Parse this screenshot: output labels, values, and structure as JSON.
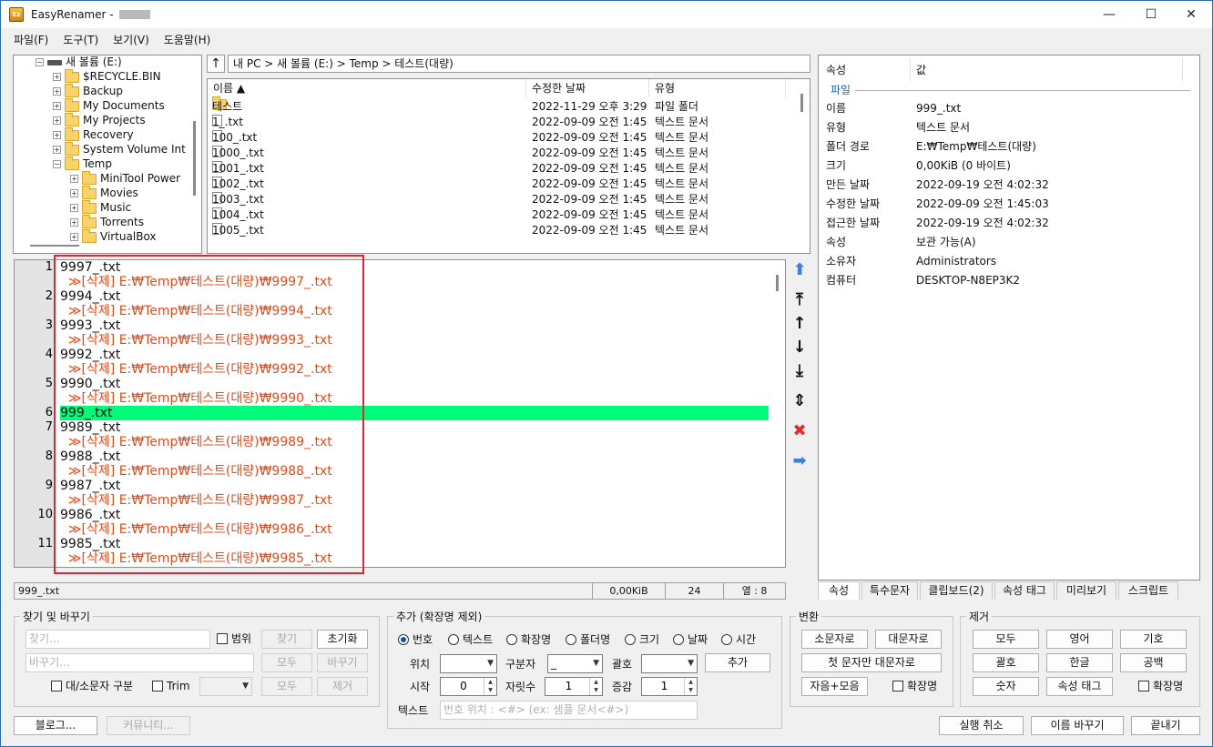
{
  "window": {
    "title": "EasyRenamer -",
    "min": "—",
    "max": "☐",
    "close": "✕"
  },
  "menu": [
    "파일(F)",
    "도구(T)",
    "보기(V)",
    "도움말(H)"
  ],
  "tree": [
    {
      "label": "새 볼륨 (E:)",
      "indent": 0,
      "icon": "drive",
      "exp": "−"
    },
    {
      "label": "$RECYCLE.BIN",
      "indent": 1,
      "icon": "folder",
      "exp": "+"
    },
    {
      "label": "Backup",
      "indent": 1,
      "icon": "folder",
      "exp": "+"
    },
    {
      "label": "My Documents",
      "indent": 1,
      "icon": "folder",
      "exp": "+"
    },
    {
      "label": "My Projects",
      "indent": 1,
      "icon": "folder",
      "exp": "+"
    },
    {
      "label": "Recovery",
      "indent": 1,
      "icon": "folder",
      "exp": "+"
    },
    {
      "label": "System Volume Int",
      "indent": 1,
      "icon": "folder",
      "exp": "+"
    },
    {
      "label": "Temp",
      "indent": 1,
      "icon": "folder",
      "exp": "−"
    },
    {
      "label": "MiniTool Power",
      "indent": 2,
      "icon": "folder",
      "exp": "+"
    },
    {
      "label": "Movies",
      "indent": 2,
      "icon": "folder",
      "exp": "+"
    },
    {
      "label": "Music",
      "indent": 2,
      "icon": "folder",
      "exp": "+"
    },
    {
      "label": "Torrents",
      "indent": 2,
      "icon": "folder",
      "exp": "+"
    },
    {
      "label": "VirtualBox",
      "indent": 2,
      "icon": "folder",
      "exp": "+"
    }
  ],
  "address": {
    "up": "↑",
    "path": "내 PC > 새 볼륨 (E:) > Temp > 테스트(대량)"
  },
  "filelist": {
    "columns": [
      "이름 ▲",
      "수정한 날짜",
      "유형"
    ],
    "rows": [
      {
        "name": "테스트",
        "date": "2022-11-29 오후 3:29",
        "type": "파일 폴더",
        "folder": true
      },
      {
        "name": "1_.txt",
        "date": "2022-09-09 오전 1:45",
        "type": "텍스트 문서"
      },
      {
        "name": "100_.txt",
        "date": "2022-09-09 오전 1:45",
        "type": "텍스트 문서"
      },
      {
        "name": "1000_.txt",
        "date": "2022-09-09 오전 1:45",
        "type": "텍스트 문서"
      },
      {
        "name": "1001_.txt",
        "date": "2022-09-09 오전 1:45",
        "type": "텍스트 문서"
      },
      {
        "name": "1002_.txt",
        "date": "2022-09-09 오전 1:45",
        "type": "텍스트 문서"
      },
      {
        "name": "1003_.txt",
        "date": "2022-09-09 오전 1:45",
        "type": "텍스트 문서"
      },
      {
        "name": "1004_.txt",
        "date": "2022-09-09 오전 1:45",
        "type": "텍스트 문서"
      },
      {
        "name": "1005_.txt",
        "date": "2022-09-09 오전 1:45",
        "type": "텍스트 문서"
      }
    ]
  },
  "editor": {
    "lines": [
      {
        "num": "1",
        "text": "9997_.txt"
      },
      {
        "num": "",
        "text": "  ≫[삭제] E:₩Temp₩테스트(대량)₩9997_.txt",
        "del": true
      },
      {
        "num": "2",
        "text": "9994_.txt"
      },
      {
        "num": "",
        "text": "  ≫[삭제] E:₩Temp₩테스트(대량)₩9994_.txt",
        "del": true
      },
      {
        "num": "3",
        "text": "9993_.txt"
      },
      {
        "num": "",
        "text": "  ≫[삭제] E:₩Temp₩테스트(대량)₩9993_.txt",
        "del": true
      },
      {
        "num": "4",
        "text": "9992_.txt"
      },
      {
        "num": "",
        "text": "  ≫[삭제] E:₩Temp₩테스트(대량)₩9992_.txt",
        "del": true
      },
      {
        "num": "5",
        "text": "9990_.txt"
      },
      {
        "num": "",
        "text": "  ≫[삭제] E:₩Temp₩테스트(대량)₩9990_.txt",
        "del": true
      },
      {
        "num": "6",
        "text": "999_.txt",
        "hl": true
      },
      {
        "num": "7",
        "text": "9989_.txt"
      },
      {
        "num": "",
        "text": "  ≫[삭제] E:₩Temp₩테스트(대량)₩9989_.txt",
        "del": true
      },
      {
        "num": "8",
        "text": "9988_.txt"
      },
      {
        "num": "",
        "text": "  ≫[삭제] E:₩Temp₩테스트(대량)₩9988_.txt",
        "del": true
      },
      {
        "num": "9",
        "text": "9987_.txt"
      },
      {
        "num": "",
        "text": "  ≫[삭제] E:₩Temp₩테스트(대량)₩9987_.txt",
        "del": true
      },
      {
        "num": "10",
        "text": "9986_.txt"
      },
      {
        "num": "",
        "text": "  ≫[삭제] E:₩Temp₩테스트(대량)₩9986_.txt",
        "del": true
      },
      {
        "num": "11",
        "text": "9985_.txt"
      },
      {
        "num": "",
        "text": "  ≫[삭제] E:₩Temp₩테스트(대량)₩9985_.txt",
        "del": true
      }
    ]
  },
  "side_buttons": [
    {
      "name": "move-up-blue-icon",
      "glyph": "⬆",
      "color": "#3d7fe0"
    },
    {
      "name": "move-top-icon",
      "glyph": "⤒",
      "color": "#111"
    },
    {
      "name": "move-up-icon",
      "glyph": "↑",
      "color": "#111"
    },
    {
      "name": "move-down-icon",
      "glyph": "↓",
      "color": "#111"
    },
    {
      "name": "move-bottom-icon",
      "glyph": "⤓",
      "color": "#111"
    },
    {
      "name": "swap-icon",
      "glyph": "⇕",
      "color": "#111"
    },
    {
      "name": "delete-icon",
      "glyph": "✖",
      "color": "#e02d2d"
    },
    {
      "name": "apply-right-icon",
      "glyph": "➡",
      "color": "#3d7fe0"
    }
  ],
  "status": {
    "name": "999_.txt",
    "size": "0,00KiB",
    "count": "24",
    "col": "열 : 8"
  },
  "properties": {
    "header_key": "속성",
    "header_val": "값",
    "section": "파일",
    "rows": [
      {
        "k": "이름",
        "v": "999_.txt"
      },
      {
        "k": "유형",
        "v": "텍스트 문서"
      },
      {
        "k": "폴더 경로",
        "v": "E:₩Temp₩테스트(대량)"
      },
      {
        "k": "크기",
        "v": "0,00KiB (0 바이트)"
      },
      {
        "k": "만든 날짜",
        "v": "2022-09-19 오전 4:02:32"
      },
      {
        "k": "수정한 날짜",
        "v": "2022-09-09 오전 1:45:03"
      },
      {
        "k": "접근한 날짜",
        "v": "2022-09-19 오전 4:02:32"
      },
      {
        "k": "속성",
        "v": "보관 가능(A)"
      },
      {
        "k": "소유자",
        "v": "Administrators"
      },
      {
        "k": "컴퓨터",
        "v": "DESKTOP-N8EP3K2"
      }
    ]
  },
  "tabs": [
    "속성",
    "특수문자",
    "클립보드(2)",
    "속성 태그",
    "미리보기",
    "스크립트"
  ],
  "find": {
    "title": "찾기 및 바꾸기",
    "find_ph": "찾기...",
    "replace_ph": "바꾸기...",
    "range": "범위",
    "case": "대/소문자 구분",
    "trim": "Trim",
    "btn_find": "찾기",
    "btn_reset": "초기화",
    "btn_all1": "모두",
    "btn_replace": "바꾸기",
    "btn_all2": "모두",
    "btn_remove": "제거"
  },
  "add": {
    "title": "추가 (확장명 제외)",
    "radios": [
      "번호",
      "텍스트",
      "확장명",
      "폴더명",
      "크기",
      "날짜",
      "시간"
    ],
    "pos": "위치",
    "sep": "구분자",
    "sep_val": "_",
    "bracket": "괄호",
    "btn_add": "추가",
    "start": "시작",
    "start_val": "0",
    "digits": "자릿수",
    "digits_val": "1",
    "inc": "증감",
    "inc_val": "1",
    "text": "텍스트",
    "text_ph": "번호 위치 : <#> (ex: 샘플 문서<#>)"
  },
  "convert": {
    "title": "변환",
    "lower": "소문자로",
    "upper": "대문자로",
    "first_upper": "첫 문자만 대문자로",
    "jamo": "자음+모음",
    "ext": "확장명"
  },
  "remove": {
    "title": "제거",
    "all": "모두",
    "eng": "영어",
    "sym": "기호",
    "paren": "괄호",
    "kor": "한글",
    "space": "공백",
    "num": "숫자",
    "tag": "속성 태그",
    "ext": "확장명"
  },
  "bottom": {
    "blog": "블로그...",
    "community": "커뮤니티...",
    "undo": "실행 취소",
    "rename": "이름 바꾸기",
    "exit": "끝내기"
  }
}
